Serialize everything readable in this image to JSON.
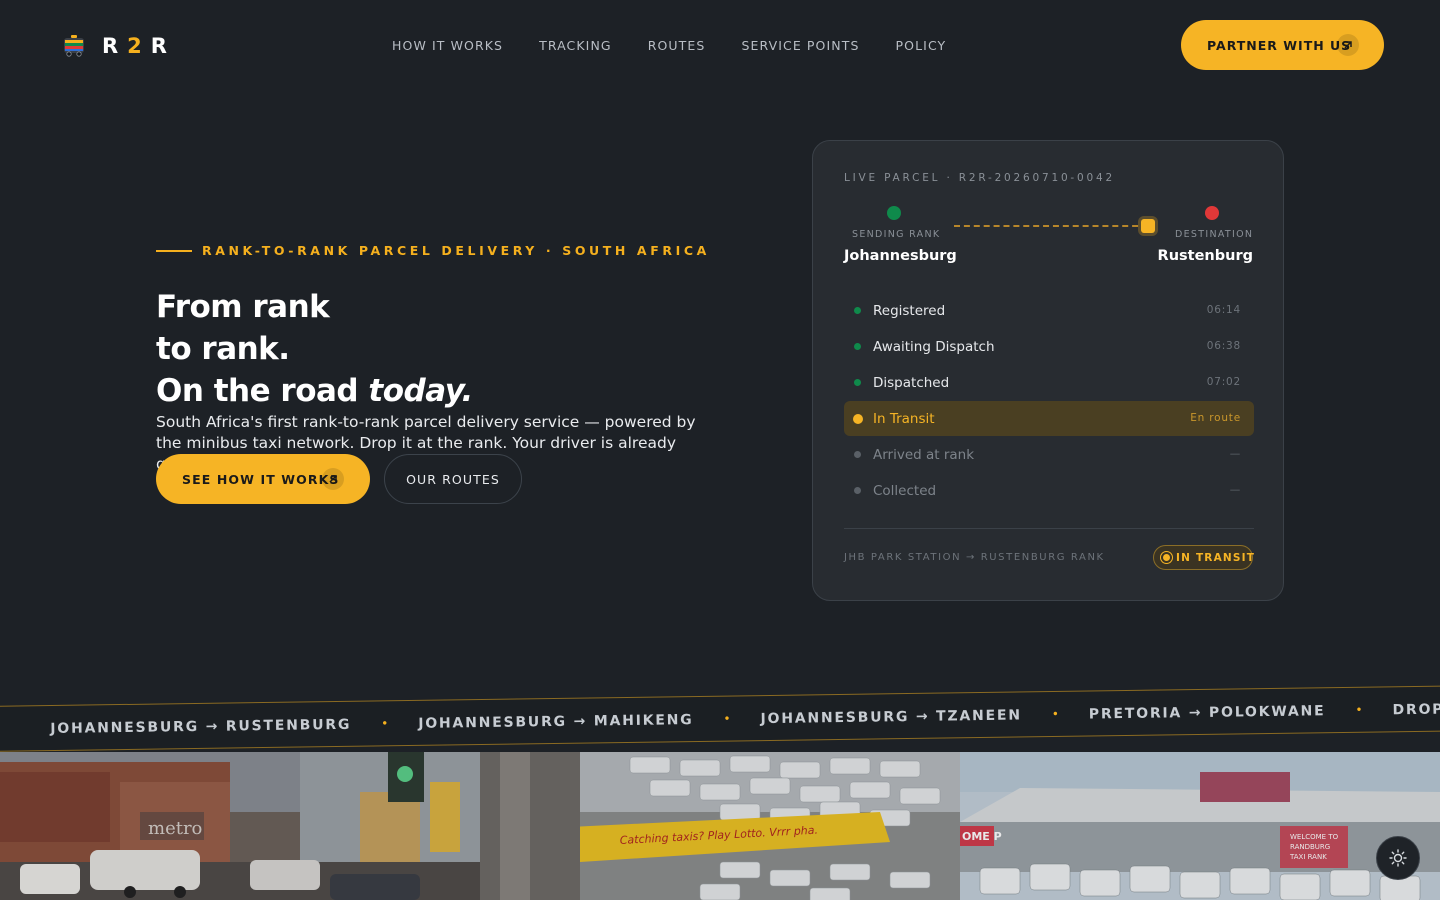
{
  "brand": {
    "logo_text_first": "R",
    "logo_text_middle": "2",
    "logo_text_last": "R",
    "logo_icon": "minibus-taxi-icon",
    "accent_color": "#f6b425"
  },
  "nav": {
    "items": [
      "HOW IT WORKS",
      "TRACKING",
      "ROUTES",
      "SERVICE POINTS",
      "POLICY"
    ]
  },
  "header": {
    "partner_label": "PARTNER WITH US",
    "partner_icon": "arrow-up-right-icon"
  },
  "hero": {
    "eyebrow": "RANK-TO-RANK PARCEL DELIVERY · SOUTH AFRICA",
    "headline_line1": "From rank",
    "headline_line2": "to rank.",
    "headline_line3_prefix": "On the road ",
    "headline_line3_emphasis": "today.",
    "subcopy": "South Africa's first rank-to-rank parcel delivery service — powered by the minibus taxi network. Drop it at the rank. Your driver is already going there.",
    "primary_button": "SEE HOW IT WORKS",
    "secondary_button": "OUR ROUTES"
  },
  "tracking_card": {
    "label": "LIVE PARCEL · R2R-20260710-0042",
    "from_label": "SENDING RANK",
    "from_city": "Johannesburg",
    "to_label": "DESTINATION",
    "to_city": "Rustenburg",
    "progress": 0.93,
    "steps": [
      {
        "label": "Registered",
        "time": "06:14",
        "state": "done"
      },
      {
        "label": "Awaiting Dispatch",
        "time": "06:38",
        "state": "done"
      },
      {
        "label": "Dispatched",
        "time": "07:02",
        "state": "done"
      },
      {
        "label": "In Transit",
        "time": "En route",
        "state": "active"
      },
      {
        "label": "Arrived at rank",
        "time": "—",
        "state": "pending"
      },
      {
        "label": "Collected",
        "time": "—",
        "state": "pending"
      }
    ],
    "route_text": "JHB PARK STATION → RUSTENBURG RANK",
    "status": "IN TRANSIT",
    "colors": {
      "done": "#0f8a4b",
      "destination": "#e03838",
      "active": "#f6b425"
    }
  },
  "ticker": {
    "items": [
      "JOHANNESBURG → RUSTENBURG",
      "JOHANNESBURG → MAHIKENG",
      "JOHANNESBURG → TZANEEN",
      "PRETORIA → POLOKWANE",
      "DROP AT"
    ],
    "separator": "•"
  },
  "photos": {
    "sign_1": "metro",
    "sign_2": "Catching taxis? Play Lotto. Vrrr pha.",
    "sign_3_a": "WELCOME TO",
    "sign_3_b": "RANDBURG",
    "sign_3_c": "TAXI RANK",
    "sign_3_side": "OME P"
  },
  "theme_toggle": {
    "icon": "sun-icon"
  }
}
